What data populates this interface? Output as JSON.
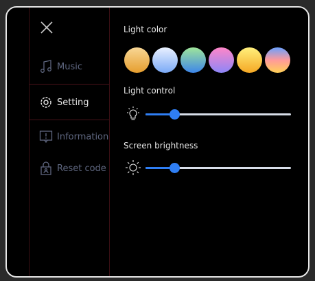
{
  "sidebar": {
    "close_icon": "close-icon",
    "items": [
      {
        "label": "Music",
        "icon": "music-note-icon",
        "active": false
      },
      {
        "label": "Setting",
        "icon": "gear-icon",
        "active": true
      },
      {
        "label": "Information",
        "icon": "info-icon",
        "active": false
      },
      {
        "label": "Reset code",
        "icon": "lock-reset-icon",
        "active": false
      }
    ]
  },
  "settings": {
    "light_color": {
      "title": "Light color",
      "swatches": [
        {
          "name": "warm-amber",
          "gradient": [
            "#f8d795",
            "#e69e2e"
          ]
        },
        {
          "name": "sky-blue",
          "gradient": [
            "#e9f1ff",
            "#7aa9f6"
          ]
        },
        {
          "name": "mint-blue",
          "gradient": [
            "#9fe59a",
            "#3d86ea"
          ]
        },
        {
          "name": "pink-violet",
          "gradient": [
            "#ff86c8",
            "#8d86f8"
          ]
        },
        {
          "name": "sunny-yellow",
          "gradient": [
            "#fff07c",
            "#f5a824"
          ]
        },
        {
          "name": "rainbow",
          "gradient": [
            "#6aa0ff",
            "#ff9a9a",
            "#ffd056"
          ]
        }
      ]
    },
    "light_control": {
      "title": "Light control",
      "icon": "light-bulb-icon",
      "value": 0.2
    },
    "screen_brightness": {
      "title": "Screen brightness",
      "icon": "sun-icon",
      "value": 0.2
    }
  },
  "colors": {
    "accent": "#2f7ef3",
    "divider": "#4a1219",
    "inactive_text": "#5f6780",
    "active_text": "#e8e8e8"
  }
}
